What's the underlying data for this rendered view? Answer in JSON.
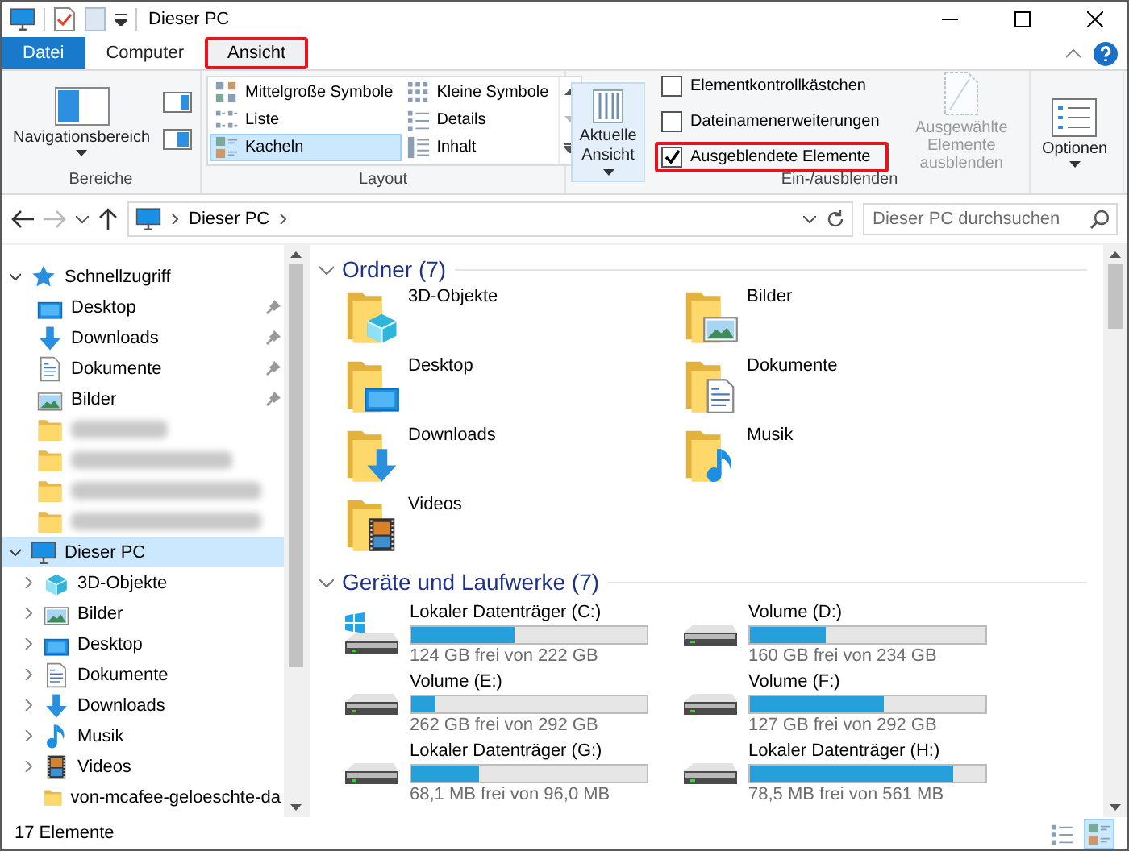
{
  "title_bar": {
    "title": "Dieser PC"
  },
  "ribbon_tabs": [
    {
      "label": "Datei",
      "kind": "file",
      "selected": false,
      "highlighted": false
    },
    {
      "label": "Computer",
      "kind": "tab",
      "selected": false,
      "highlighted": false
    },
    {
      "label": "Ansicht",
      "kind": "tab",
      "selected": true,
      "highlighted": true
    }
  ],
  "ribbon": {
    "panes": {
      "button": "Navigationsbereich",
      "group_label": "Bereiche"
    },
    "layout": {
      "options": [
        {
          "label": "Mittelgroße Symbole",
          "kind": "medium",
          "selected": false
        },
        {
          "label": "Kleine Symbole",
          "kind": "small",
          "selected": false
        },
        {
          "label": "Liste",
          "kind": "list",
          "selected": false
        },
        {
          "label": "Details",
          "kind": "details",
          "selected": false
        },
        {
          "label": "Kacheln",
          "kind": "tiles",
          "selected": true
        },
        {
          "label": "Inhalt",
          "kind": "content",
          "selected": false
        }
      ],
      "group_label": "Layout"
    },
    "current_view": {
      "button": "Aktuelle Ansicht"
    },
    "show_hide": {
      "options": [
        {
          "label": "Elementkontrollkästchen",
          "checked": false,
          "highlighted": false
        },
        {
          "label": "Dateinamenerweiterungen",
          "checked": false,
          "highlighted": false
        },
        {
          "label": "Ausgeblendete Elemente",
          "checked": true,
          "highlighted": true
        }
      ],
      "hide_selected": {
        "label": "Ausgewählte Elemente ausblenden",
        "disabled": true
      },
      "group_label": "Ein-/ausblenden"
    },
    "options": {
      "button": "Optionen"
    }
  },
  "address_bar": {
    "path": [
      "Dieser PC"
    ],
    "search_placeholder": "Dieser PC durchsuchen"
  },
  "nav": {
    "items": [
      {
        "label": "Schnellzugriff",
        "kind": "star",
        "expanded": true,
        "selected": false,
        "children": [
          {
            "label": "Desktop",
            "kind": "desktop",
            "pinned": true,
            "selected": false
          },
          {
            "label": "Downloads",
            "kind": "downloads",
            "pinned": true,
            "selected": false
          },
          {
            "label": "Dokumente",
            "kind": "documents",
            "pinned": true,
            "selected": false
          },
          {
            "label": "Bilder",
            "kind": "pictures",
            "pinned": true,
            "selected": false
          },
          {
            "kind": "blurred",
            "selected": false
          },
          {
            "kind": "blurred",
            "selected": false
          },
          {
            "kind": "blurred",
            "selected": false
          },
          {
            "kind": "blurred",
            "selected": false
          }
        ]
      },
      {
        "label": "Dieser PC",
        "kind": "computer",
        "expanded": true,
        "selected": true,
        "children": [
          {
            "label": "3D-Objekte",
            "kind": "objects",
            "expanded": false,
            "selected": false
          },
          {
            "label": "Bilder",
            "kind": "pictures",
            "expanded": false,
            "selected": false
          },
          {
            "label": "Desktop",
            "kind": "desktop",
            "expanded": false,
            "selected": false
          },
          {
            "label": "Dokumente",
            "kind": "documents",
            "expanded": false,
            "selected": false
          },
          {
            "label": "Downloads",
            "kind": "downloads",
            "expanded": false,
            "selected": false
          },
          {
            "label": "Musik",
            "kind": "music",
            "expanded": false,
            "selected": false
          },
          {
            "label": "Videos",
            "kind": "videos",
            "expanded": false,
            "selected": false
          },
          {
            "label": "von-mcafee-geloeschte-da",
            "kind": "folder",
            "selected": false
          }
        ]
      }
    ]
  },
  "sections": [
    {
      "title": "Ordner (7)",
      "kind": "folders",
      "expanded": true,
      "items": [
        {
          "name": "3D-Objekte",
          "kind": "objects"
        },
        {
          "name": "Bilder",
          "kind": "pictures"
        },
        {
          "name": "Desktop",
          "kind": "desktop"
        },
        {
          "name": "Dokumente",
          "kind": "documents"
        },
        {
          "name": "Downloads",
          "kind": "downloads"
        },
        {
          "name": "Musik",
          "kind": "music"
        },
        {
          "name": "Videos",
          "kind": "videos"
        }
      ]
    },
    {
      "title": "Geräte und Laufwerke (7)",
      "kind": "drives",
      "expanded": true,
      "items": [
        {
          "name": "Lokaler Datenträger (C:)",
          "kind": "system",
          "level": 0.44,
          "free": "124 GB frei von 222 GB"
        },
        {
          "name": "Volume (D:)",
          "kind": "drive",
          "level": 0.32,
          "free": "160 GB frei von 234 GB"
        },
        {
          "name": "Volume (E:)",
          "kind": "drive",
          "level": 0.1,
          "free": "262 GB frei von 292 GB"
        },
        {
          "name": "Volume (F:)",
          "kind": "drive",
          "level": 0.57,
          "free": "127 GB frei von 292 GB"
        },
        {
          "name": "Lokaler Datenträger (G:)",
          "kind": "drive",
          "level": 0.29,
          "free": "68,1 MB frei von 96,0 MB"
        },
        {
          "name": "Lokaler Datenträger (H:)",
          "kind": "drive",
          "level": 0.86,
          "free": "78,5 MB frei von 561 MB"
        }
      ]
    }
  ],
  "status_bar": {
    "count": "17 Elemente",
    "view_buttons": [
      {
        "kind": "details",
        "selected": false
      },
      {
        "kind": "tiles",
        "selected": true
      }
    ]
  }
}
